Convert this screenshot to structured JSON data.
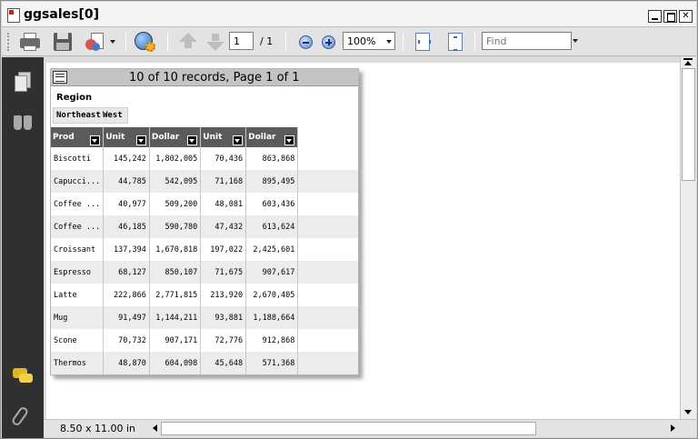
{
  "window": {
    "title": "ggsales[0]"
  },
  "toolbar": {
    "page_current": "1",
    "page_total": "/ 1",
    "zoom": "100%",
    "find_placeholder": "Find"
  },
  "report": {
    "records_text": "10 of 10 records, Page 1 of 1",
    "region_label": "Region",
    "regions": [
      "Northeast",
      "West"
    ],
    "columns": [
      "Prod",
      "Unit",
      "Dollar",
      "Unit",
      "Dollar"
    ],
    "rows": [
      [
        "Biscotti",
        "145,242",
        "1,802,005",
        "70,436",
        "863,868"
      ],
      [
        "Capucci...",
        "44,785",
        "542,095",
        "71,168",
        "895,495"
      ],
      [
        "Coffee ...",
        "40,977",
        "509,200",
        "48,081",
        "603,436"
      ],
      [
        "Coffee ...",
        "46,185",
        "590,780",
        "47,432",
        "613,624"
      ],
      [
        "Croissant",
        "137,394",
        "1,670,818",
        "197,022",
        "2,425,601"
      ],
      [
        "Espresso",
        "68,127",
        "850,107",
        "71,675",
        "907,617"
      ],
      [
        "Latte",
        "222,866",
        "2,771,815",
        "213,920",
        "2,670,405"
      ],
      [
        "Mug",
        "91,497",
        "1,144,211",
        "93,881",
        "1,188,664"
      ],
      [
        "Scone",
        "70,732",
        "907,171",
        "72,776",
        "912,868"
      ],
      [
        "Thermos",
        "48,870",
        "604,098",
        "45,648",
        "571,368"
      ]
    ]
  },
  "status": {
    "page_size": "8.50 x 11.00 in"
  }
}
